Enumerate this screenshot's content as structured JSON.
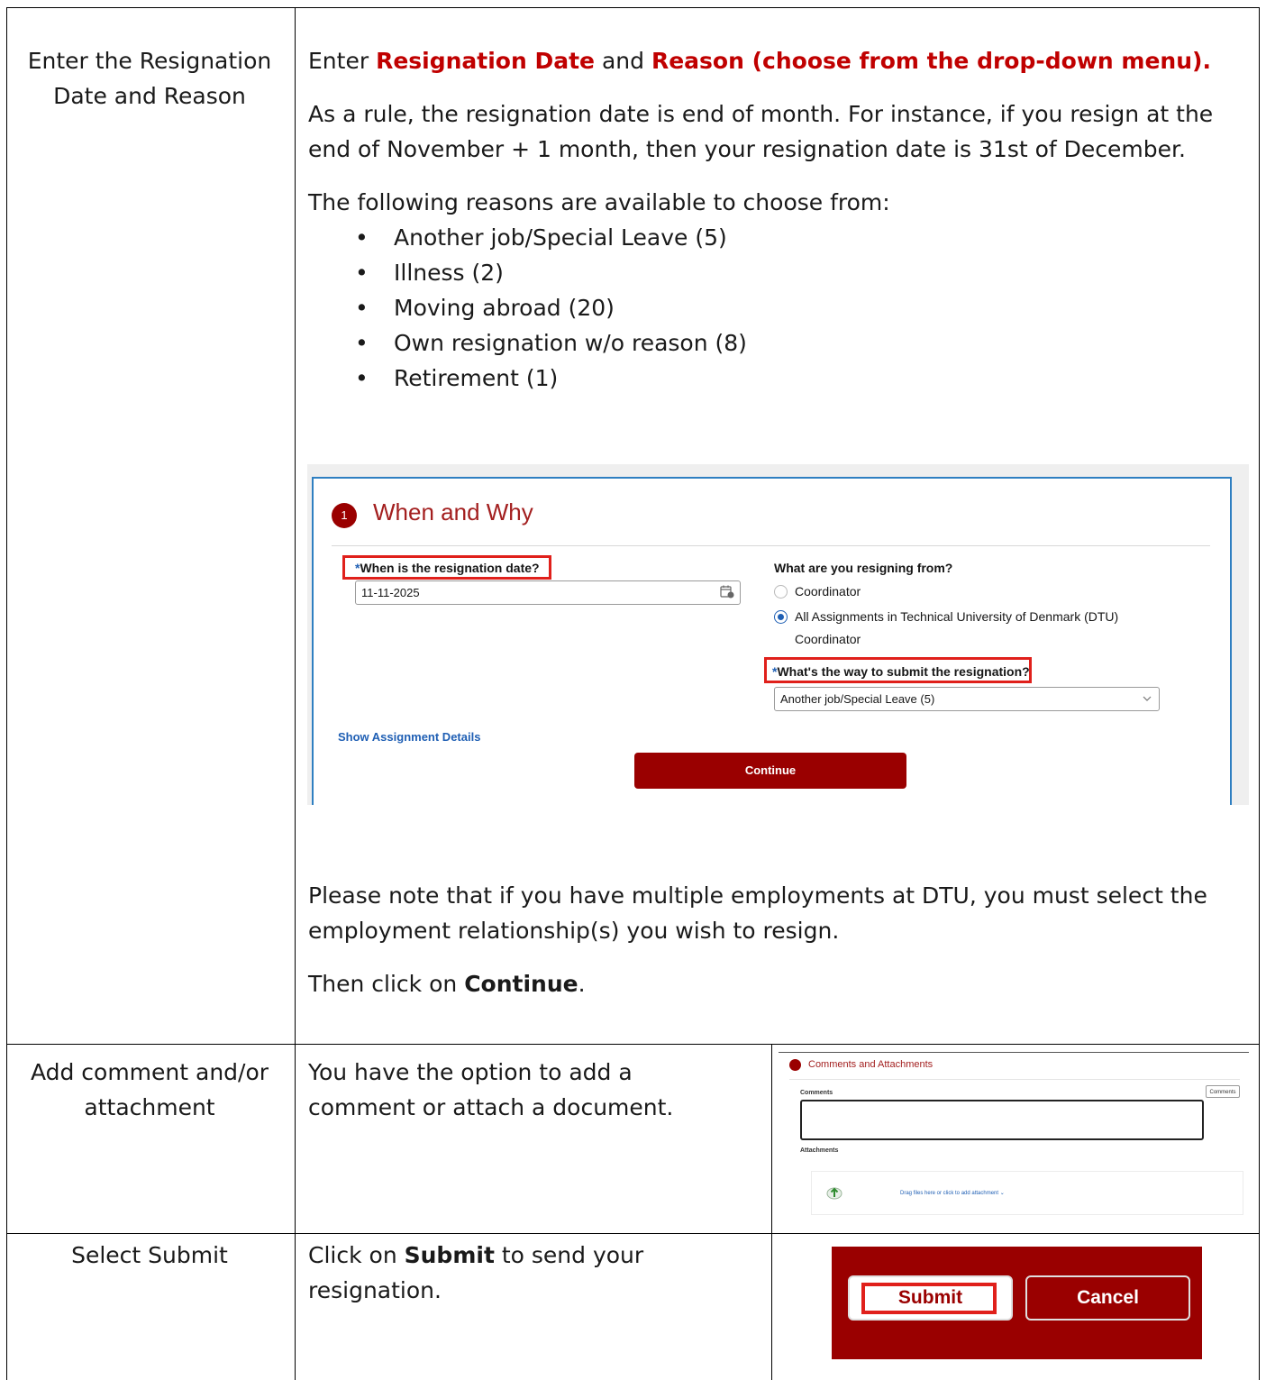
{
  "rows": [
    {
      "step": "Enter the Resignation Date and Reason",
      "intro_prefix": "Enter",
      "intro_field1": "Resignation Date",
      "intro_and": "and",
      "intro_field2": "Reason (choose from the drop-down menu).",
      "rule_text": "As a rule, the resignation date is end of month. For instance, if you resign at the end of November + 1 month, then your resignation date is 31st of December.",
      "reasons_intro": "The following reasons are available to choose from:",
      "reasons": [
        "Another job/Special Leave (5)",
        "Illness (2)",
        "Moving abroad (20)",
        "Own resignation w/o reason (8)",
        "Retirement (1)"
      ],
      "note_text": "Please note that if you have multiple employments at DTU, you must select the employment relationship(s) you wish to resign.",
      "then_prefix": "Then click on",
      "then_bold": "Continue",
      "then_suffix": "."
    },
    {
      "step": "Add comment and/or attachment",
      "text": "You have the option to add a comment or attach a document."
    },
    {
      "step": "Select Submit",
      "text_prefix": "Click on",
      "text_bold": "Submit",
      "text_suffix": "to send your resignation."
    }
  ],
  "form_when_why": {
    "step_number": "1",
    "title": "When and Why",
    "date_label_required": "*",
    "date_label": "When is the resignation date?",
    "date_value": "11-11-2025",
    "resign_from_label": "What are you resigning from?",
    "options": [
      {
        "label": "Coordinator",
        "selected": false
      },
      {
        "label": "All Assignments in Technical University of Denmark (DTU)",
        "selected": true
      }
    ],
    "option_sublabel": "Coordinator",
    "way_label_required": "*",
    "way_label": "What's the way to submit the resignation?",
    "way_value": "Another job/Special Leave (5)",
    "show_details_link": "Show Assignment Details",
    "continue_button": "Continue"
  },
  "form_comments": {
    "title": "Comments and Attachments",
    "comments_label": "Comments",
    "comments_button": "Comments",
    "attachments_label": "Attachments",
    "drop_text": "Drag files here or click to add attachment"
  },
  "form_submit": {
    "submit_button": "Submit",
    "cancel_button": "Cancel"
  },
  "colors": {
    "brand": "#9a0000",
    "highlight": "#e0201b",
    "link": "#1f5fb4",
    "emphasis": "#c00000"
  }
}
